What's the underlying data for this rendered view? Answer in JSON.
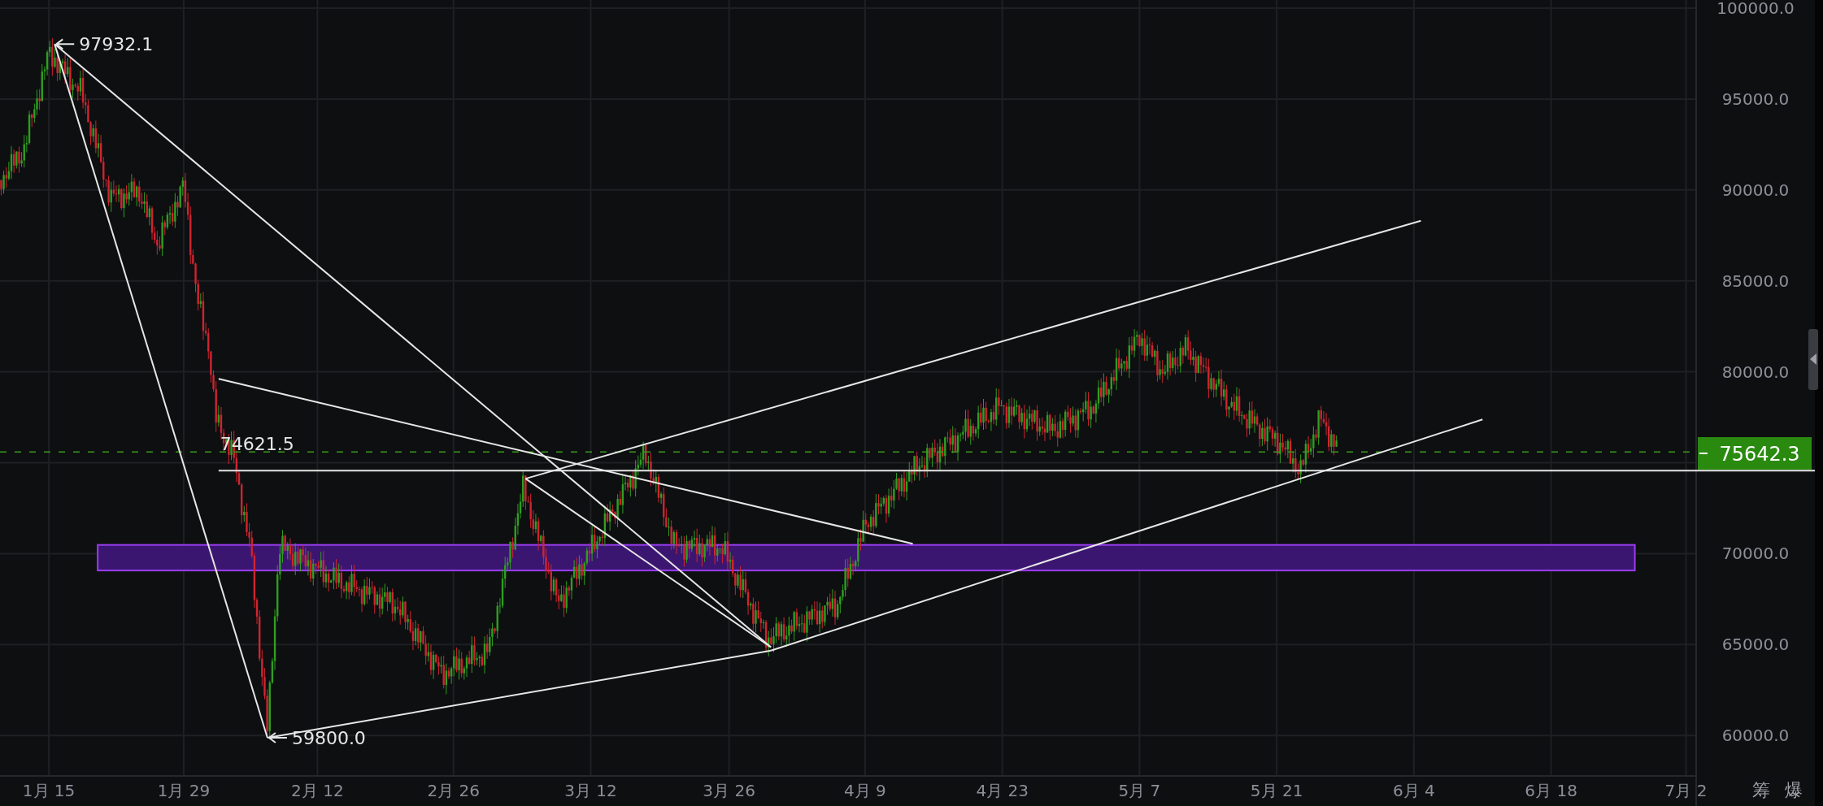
{
  "price_axis": {
    "ticks": [
      {
        "label": "100000.0"
      },
      {
        "label": "95000.0"
      },
      {
        "label": "90000.0"
      },
      {
        "label": "85000.0"
      },
      {
        "label": "80000.0"
      },
      {
        "label": "70000.0"
      },
      {
        "label": "65000.0"
      },
      {
        "label": "60000.0"
      }
    ]
  },
  "time_axis": {
    "ticks": [
      "1月 15",
      "1月 29",
      "2月 12",
      "2月 26",
      "3月 12",
      "3月 26",
      "4月 9",
      "4月 23",
      "5月 7",
      "5月 21",
      "6月 4",
      "6月 18",
      "7月 2"
    ]
  },
  "annotations": [
    {
      "kind": "high",
      "text": "97932.1"
    },
    {
      "kind": "low",
      "text": "59800.0"
    },
    {
      "kind": "level",
      "text": "74621.5"
    }
  ],
  "last_price": {
    "text": "75642.3"
  },
  "toolbar_buttons": [
    "筹",
    "爆"
  ]
}
